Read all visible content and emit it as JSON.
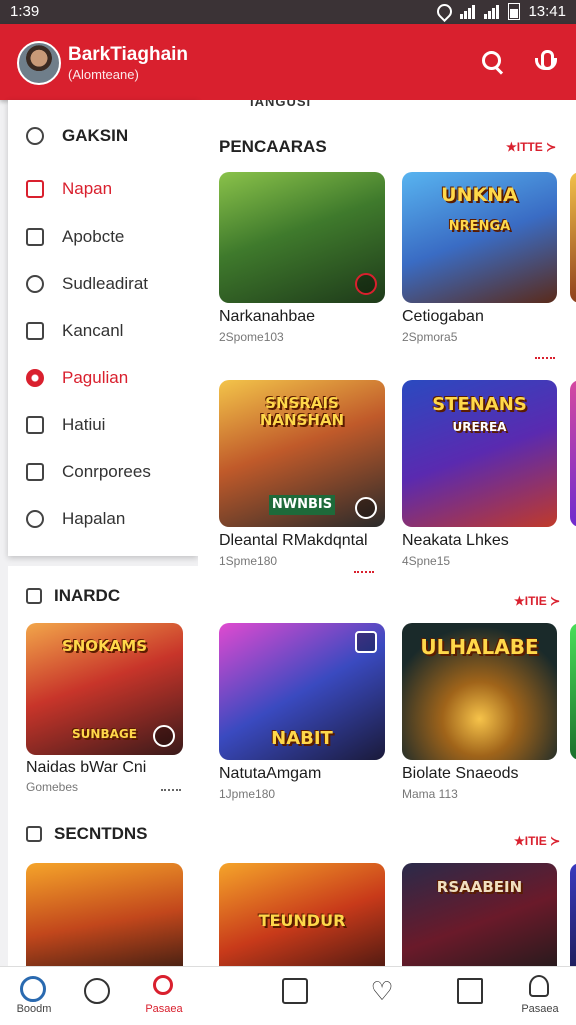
{
  "status_bar": {
    "time": "1:39",
    "clock_right": "13:41"
  },
  "header": {
    "name": "BarkTiaghain",
    "subtitle": "(Alomteane)",
    "search_icon": "search-icon",
    "mic_icon": "mic-icon"
  },
  "colors": {
    "accent": "#d9202e",
    "status_bar": "#3b3336"
  },
  "drawer": {
    "heading": "GAKSIN",
    "items": [
      {
        "label": "Napan",
        "icon": "store-icon",
        "active": true
      },
      {
        "label": "Apobcte",
        "icon": "square-icon"
      },
      {
        "label": "Sudleadirat",
        "icon": "refresh-icon"
      },
      {
        "label": "Kancanl",
        "icon": "edit-icon"
      },
      {
        "label": "Pagulian",
        "icon": "gear-icon",
        "active": true
      },
      {
        "label": "Hatiui",
        "icon": "tag-icon"
      },
      {
        "label": "Conrporees",
        "icon": "window-icon"
      },
      {
        "label": "Hapalan",
        "icon": "camera-icon"
      }
    ]
  },
  "left_panel": {
    "section1": {
      "title": "INARDC",
      "card": {
        "title": "Naidas bWar Cni",
        "meta": "Gomebes",
        "banner": "SNOKAMS",
        "sub_banner": "SUNBAGE"
      }
    },
    "section2": {
      "title": "SECNTDNS"
    }
  },
  "main": {
    "cutoff_label": "IANGUSI",
    "section1": {
      "title": "PENCAARAS",
      "more": "★ITTE ≻",
      "cards": [
        {
          "title": "Narkanahbae",
          "meta": "2Spome103"
        },
        {
          "title": "Cetiogaban",
          "meta": "2Spmora5",
          "banner": "UNKNA",
          "sub_banner": "NRENGA"
        }
      ]
    },
    "section2": {
      "cards": [
        {
          "title": "Dleantal RMakdqntal",
          "meta": "1Spme180",
          "banner": "SNSRAIS NANSHAN",
          "sub_banner": "NWNBIS"
        },
        {
          "title": "Neakata Lhkes",
          "meta": "4Spne15",
          "banner": "STENANS",
          "sub_banner": "UREREA"
        }
      ]
    },
    "section3": {
      "more": "★ITIE ≻",
      "cards": [
        {
          "title": "NatutaAmgam",
          "meta": "1Jpme180",
          "banner": "NABIT"
        },
        {
          "title": "Biolate Snaeods",
          "meta": "Mama 113",
          "banner": "ULHALABE"
        }
      ]
    },
    "section4": {
      "more": "★ITIE ≻",
      "cards": [
        {
          "title": "",
          "meta": "",
          "banner": "TEUNDUR"
        },
        {
          "title": "",
          "meta": "",
          "banner": "RSAABEIN"
        }
      ]
    }
  },
  "bottom_nav": [
    {
      "label": "Boodm",
      "icon": "home-icon"
    },
    {
      "label": "",
      "icon": "smile-icon"
    },
    {
      "label": "Pasaea",
      "icon": "search-icon",
      "active": true
    },
    {
      "label": "",
      "icon": "bookmark-icon"
    },
    {
      "label": "",
      "icon": "heart-icon"
    },
    {
      "label": "",
      "icon": "book-icon"
    },
    {
      "label": "Pasaea",
      "icon": "profile-icon"
    }
  ]
}
